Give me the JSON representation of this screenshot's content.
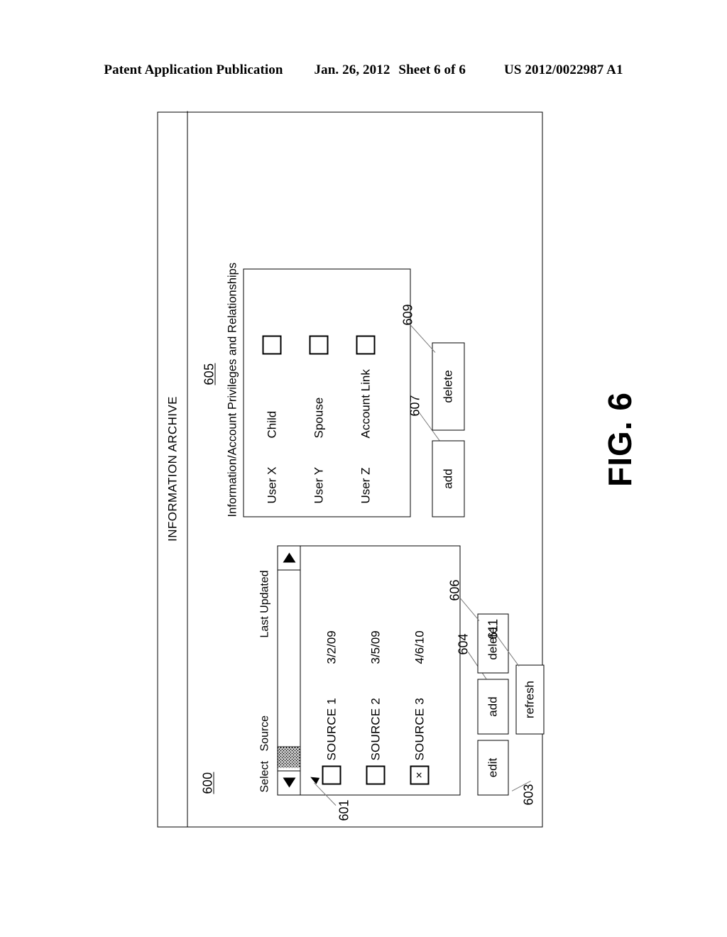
{
  "header": {
    "publication": "Patent Application Publication",
    "date": "Jan. 26, 2012",
    "sheet": "Sheet 6 of 6",
    "docnum": "US 2012/0022987 A1"
  },
  "figure": {
    "label": "FIG. 6",
    "window_ref": "600",
    "window_title": "INFORMATION ARCHIVE"
  },
  "source_panel": {
    "ref": "601",
    "headers": {
      "select": "Select",
      "source": "Source",
      "last_updated": "Last Updated"
    },
    "rows": [
      {
        "checked": "",
        "source": "SOURCE 1",
        "last_updated": "3/2/09"
      },
      {
        "checked": "",
        "source": "SOURCE 2",
        "last_updated": "3/5/09"
      },
      {
        "checked": "×",
        "source": "SOURCE 3",
        "last_updated": "4/6/10"
      }
    ],
    "scrollbar": {
      "left_arrow": "left-arrow-icon",
      "right_arrow": "right-arrow-icon"
    }
  },
  "source_buttons": [
    {
      "label": "edit",
      "ref": "603"
    },
    {
      "label": "add",
      "ref": "604"
    },
    {
      "label": "delete",
      "ref": "606"
    },
    {
      "label": "refresh",
      "ref": "611"
    }
  ],
  "privileges_panel": {
    "ref": "605",
    "caption": "Information/Account Privileges and Relationships",
    "rows": [
      {
        "user": "User X",
        "relationship": "Child",
        "checked": ""
      },
      {
        "user": "User Y",
        "relationship": "Spouse",
        "checked": ""
      },
      {
        "user": "User Z",
        "relationship": "Account Link",
        "checked": ""
      }
    ]
  },
  "privileges_buttons": [
    {
      "label": "add",
      "ref": "607"
    },
    {
      "label": "delete",
      "ref": "609"
    }
  ]
}
